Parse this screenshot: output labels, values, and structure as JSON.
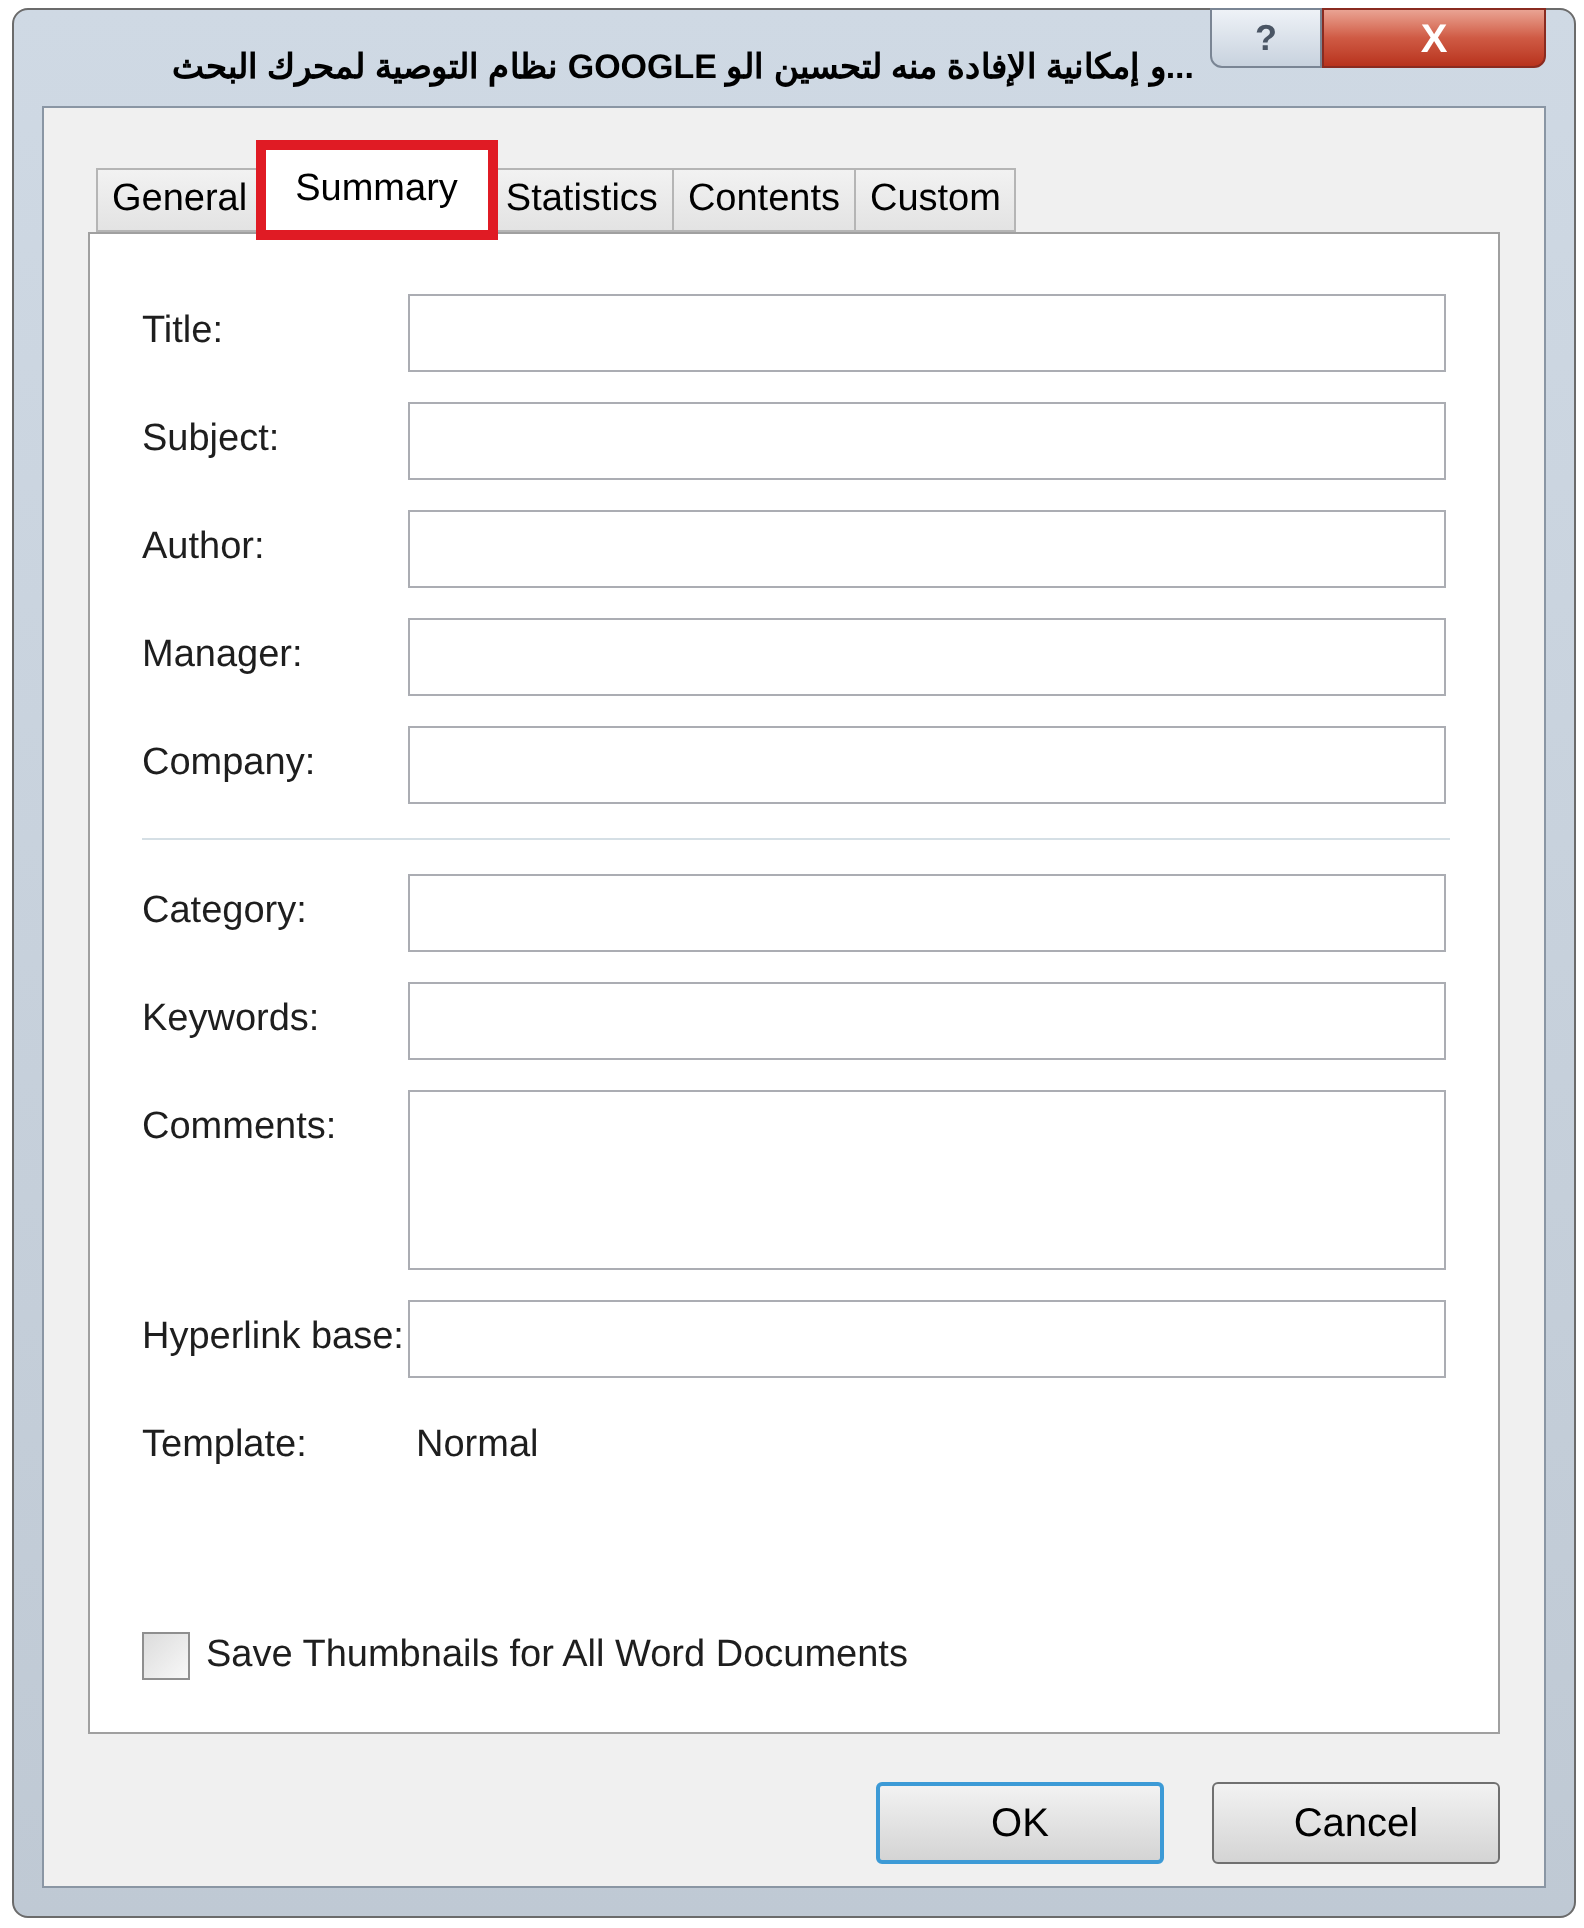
{
  "window": {
    "title": "...و إمكانية الإفادة منه لتحسين الو GOOGLE نظام التوصية لمحرك البحث",
    "help_button": "?",
    "close_button": "X"
  },
  "tabs": [
    {
      "label": "General",
      "selected": false
    },
    {
      "label": "Summary",
      "selected": true,
      "highlighted": true
    },
    {
      "label": "Statistics",
      "selected": false
    },
    {
      "label": "Contents",
      "selected": false
    },
    {
      "label": "Custom",
      "selected": false
    }
  ],
  "fields": [
    {
      "label": "Title:",
      "kind": "line"
    },
    {
      "label": "Subject:",
      "kind": "line"
    },
    {
      "label": "Author:",
      "kind": "line"
    },
    {
      "label": "Manager:",
      "kind": "line"
    },
    {
      "label": "Company:",
      "kind": "line"
    },
    {
      "kind": "divider"
    },
    {
      "label": "Category:",
      "kind": "line"
    },
    {
      "label": "Keywords:",
      "kind": "line"
    },
    {
      "label": "Comments:",
      "kind": "area"
    },
    {
      "label": "Hyperlink base:",
      "kind": "line"
    }
  ],
  "template": {
    "label": "Template:",
    "value": "Normal"
  },
  "save_thumbnails": {
    "label": "Save Thumbnails for All Word Documents",
    "checked": false
  },
  "buttons": [
    {
      "label": "OK",
      "default": true
    },
    {
      "label": "Cancel",
      "default": false
    }
  ]
}
